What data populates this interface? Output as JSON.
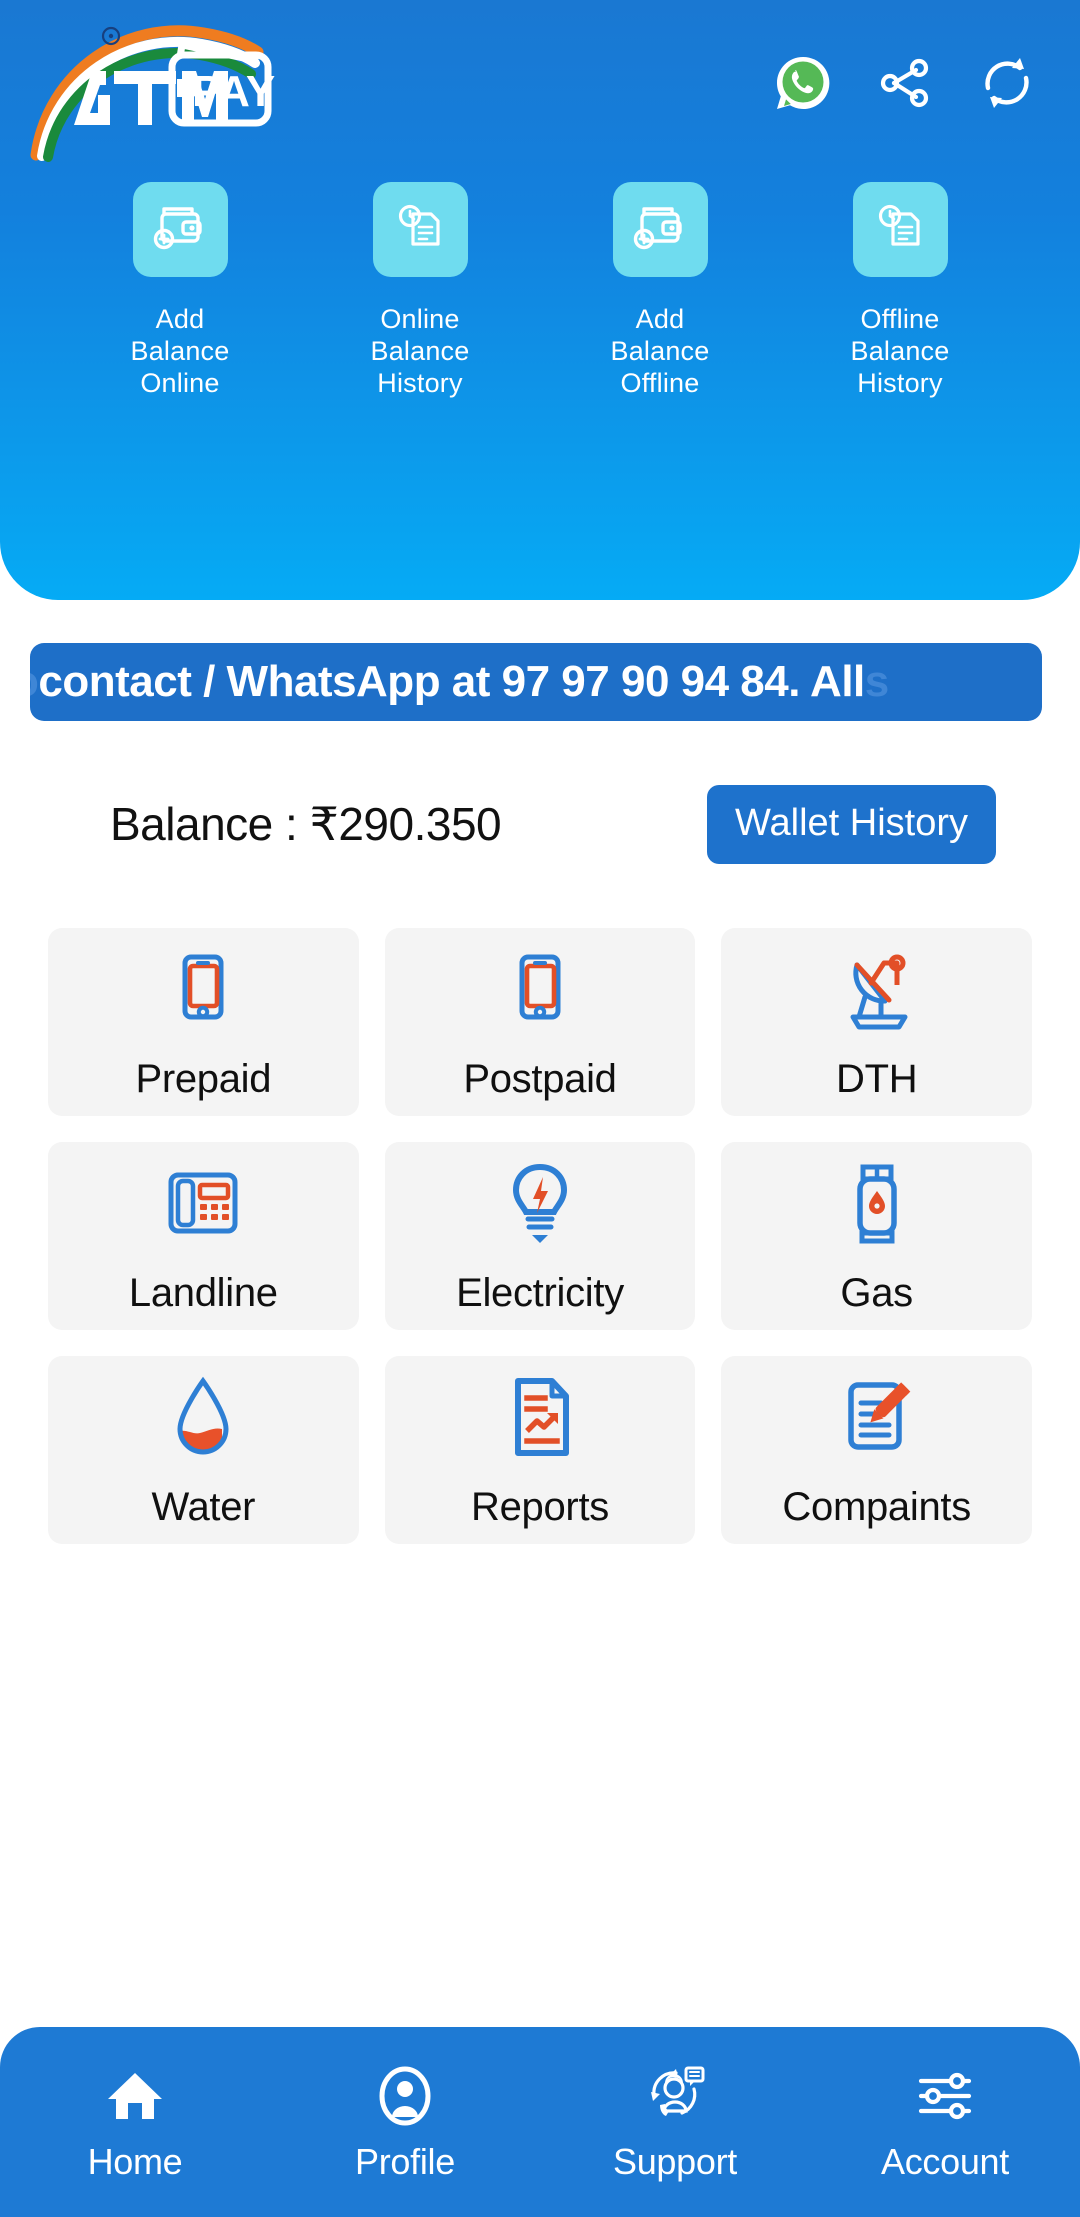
{
  "app": {
    "brand_name": "ATM",
    "brand_suffix": "PAY",
    "header_bg_top": "#1a78d2",
    "header_bg_bottom": "#05abf5",
    "accent_blue": "#1e7ad4",
    "accent_orange": "#e24f27",
    "tile_bg": "#6fdcef",
    "card_bg": "#f4f4f4"
  },
  "header": {
    "icons": [
      {
        "name": "whatsapp-icon",
        "label": "WhatsApp",
        "color": "#4caf50"
      },
      {
        "name": "share-icon",
        "label": "Share",
        "color": "#ffffff"
      },
      {
        "name": "refresh-icon",
        "label": "Refresh",
        "color": "#ffffff"
      }
    ],
    "quick_actions": [
      {
        "icon": "wallet-plus-icon",
        "label": "Add\nBalance\nOnline",
        "line1": "Add",
        "line2": "Balance",
        "line3": "Online"
      },
      {
        "icon": "history-document-icon",
        "label": "Online Balance History",
        "line1": "Online",
        "line2": "Balance",
        "line3": "History"
      },
      {
        "icon": "wallet-plus-icon",
        "label": "Add Balance Offline",
        "line1": "Add",
        "line2": "Balance",
        "line3": "Offline"
      },
      {
        "icon": "history-document-icon",
        "label": "Offline Balance History",
        "line1": "Offline",
        "line2": "Balance",
        "line3": "History"
      }
    ]
  },
  "marquee": {
    "prefix": "o",
    "text": "contact / WhatsApp at 97 97 90 94 84. All",
    "suffix": "s"
  },
  "balance": {
    "label": "Balance : ₹290.350",
    "amount": "290.350",
    "currency": "₹",
    "wallet_history_label": "Wallet History"
  },
  "services": [
    {
      "icon": "mobile-phone-icon",
      "label": "Prepaid"
    },
    {
      "icon": "mobile-phone-icon",
      "label": "Postpaid"
    },
    {
      "icon": "satellite-dish-icon",
      "label": "DTH"
    },
    {
      "icon": "landline-phone-icon",
      "label": "Landline"
    },
    {
      "icon": "light-bulb-icon",
      "label": "Electricity"
    },
    {
      "icon": "gas-cylinder-icon",
      "label": "Gas"
    },
    {
      "icon": "water-drop-icon",
      "label": "Water"
    },
    {
      "icon": "report-document-icon",
      "label": "Reports"
    },
    {
      "icon": "complaint-edit-icon",
      "label": "Compaints"
    }
  ],
  "bottom_nav": [
    {
      "icon": "home-icon",
      "label": "Home",
      "active": true
    },
    {
      "icon": "profile-person-icon",
      "label": "Profile",
      "active": false
    },
    {
      "icon": "support-agent-icon",
      "label": "Support",
      "active": false
    },
    {
      "icon": "account-sliders-icon",
      "label": "Account",
      "active": false
    }
  ]
}
